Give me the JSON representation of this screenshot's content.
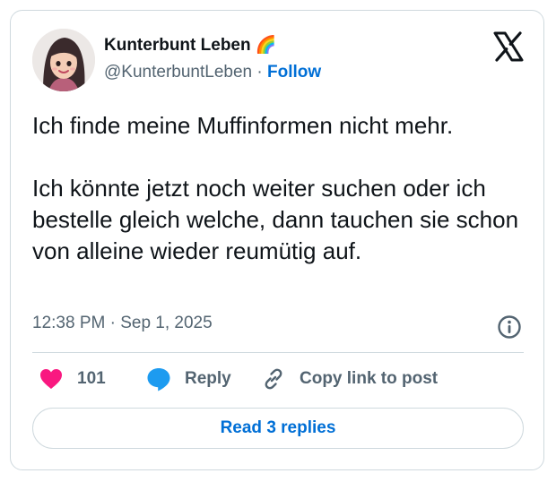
{
  "author": {
    "display_name": "Kunterbunt Leben 🌈",
    "handle": "@KunterbuntLeben",
    "separator": "·",
    "follow_label": "Follow"
  },
  "tweet": {
    "text": "Ich finde meine Muffinformen nicht mehr.\n\nIch könnte jetzt noch weiter suchen oder ich bestelle gleich welche, dann tauchen sie schon von alleine wieder reumütig auf.",
    "timestamp": "12:38 PM · Sep 1, 2025"
  },
  "actions": {
    "like_count": "101",
    "reply_label": "Reply",
    "copy_label": "Copy link to post"
  },
  "footer": {
    "read_replies_label": "Read 3 replies"
  },
  "icons": {
    "logo": "x-logo-icon",
    "info": "info-icon",
    "like": "heart-icon",
    "reply": "speech-bubble-icon",
    "copy": "link-icon"
  },
  "colors": {
    "text_primary": "#0f1419",
    "text_secondary": "#536471",
    "link_blue": "#006fd6",
    "heart_pink": "#f91880",
    "reply_blue": "#1d9bf0",
    "border": "#cfd9de"
  }
}
